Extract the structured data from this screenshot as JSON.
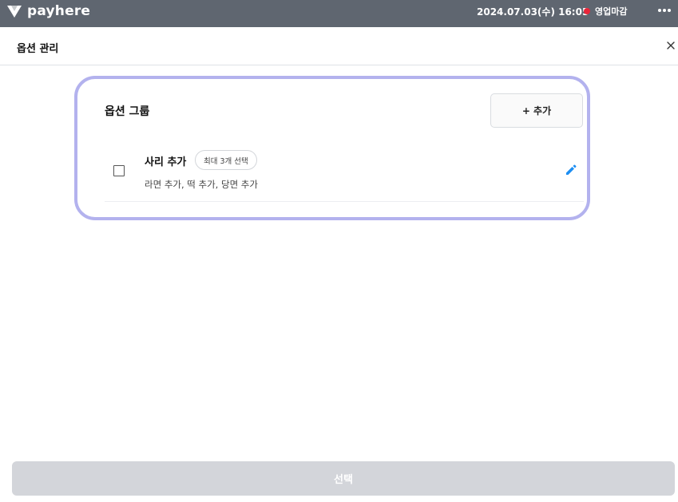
{
  "topbar": {
    "brand": "payhere",
    "datetime": "2024.07.03(수) 16:05",
    "status_label": "영업마감",
    "status_color": "#e8263a",
    "more_icon": "more-horizontal-icon"
  },
  "header": {
    "title": "옵션 관리",
    "close_icon": "close-icon"
  },
  "panel": {
    "highlight_color": "#b3b2ee",
    "group_title": "옵션 그룹",
    "add_button_label": "+ 추가",
    "options": [
      {
        "name": "사리 추가",
        "badge": "최대 3개 선택",
        "items": "라면 추가, 떡 추가, 당면 추가",
        "checked": false,
        "edit_icon": "pencil-icon"
      }
    ]
  },
  "footer": {
    "select_button_label": "선택"
  },
  "colors": {
    "topbar_bg": "#5f6670",
    "edit_icon": "#1d8ef2",
    "disabled_button": "#d3d5da"
  }
}
